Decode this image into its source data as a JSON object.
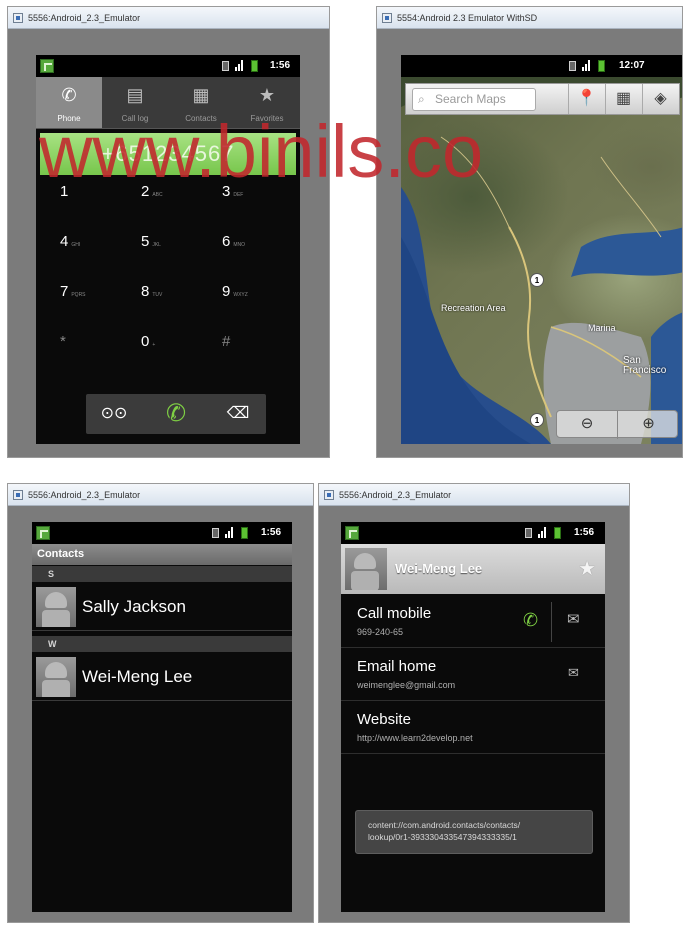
{
  "emulators": [
    {
      "title": "5556:Android_2.3_Emulator"
    },
    {
      "title": "5554:Android 2.3 Emulator WithSD"
    },
    {
      "title": "5556:Android_2.3_Emulator"
    },
    {
      "title": "5556:Android_2.3_Emulator"
    }
  ],
  "watermark": "www.binils.co",
  "colors": {
    "watermark": "#c2272d",
    "dial_green": "#77c64c",
    "call_green": "#7fd044"
  },
  "dialer": {
    "status_time": "1:56",
    "tabs": [
      {
        "label": "Phone",
        "icon": "phone-icon"
      },
      {
        "label": "Call log",
        "icon": "call-log-icon"
      },
      {
        "label": "Contacts",
        "icon": "contacts-icon"
      },
      {
        "label": "Favorites",
        "icon": "star-icon"
      }
    ],
    "number": "+651234567",
    "keys": [
      {
        "digit": "1",
        "letters": ""
      },
      {
        "digit": "2",
        "letters": "ABC"
      },
      {
        "digit": "3",
        "letters": "DEF"
      },
      {
        "digit": "4",
        "letters": "GHI"
      },
      {
        "digit": "5",
        "letters": "JKL"
      },
      {
        "digit": "6",
        "letters": "MNO"
      },
      {
        "digit": "7",
        "letters": "PQRS"
      },
      {
        "digit": "8",
        "letters": "TUV"
      },
      {
        "digit": "9",
        "letters": "WXYZ"
      },
      {
        "digit": "*",
        "letters": ""
      },
      {
        "digit": "0",
        "letters": "+"
      },
      {
        "digit": "#",
        "letters": ""
      }
    ]
  },
  "maps": {
    "status_time": "12:07",
    "search_placeholder": "Search Maps",
    "labels": {
      "recreation_area": "Recreation Area",
      "marina": "Marina",
      "san_francisco": "San\nFrancisco",
      "highway_1": "1"
    }
  },
  "contacts_list": {
    "status_time": "1:56",
    "title": "Contacts",
    "sections": [
      {
        "letter": "S",
        "name": "Sally Jackson"
      },
      {
        "letter": "W",
        "name": "Wei-Meng Lee"
      }
    ]
  },
  "contact_detail": {
    "status_time": "1:56",
    "name": "Wei-Meng Lee",
    "rows": [
      {
        "title": "Call mobile",
        "subtitle": "969-240-65"
      },
      {
        "title": "Email home",
        "subtitle": "weimenglee@gmail.com"
      },
      {
        "title": "Website",
        "subtitle": "http://www.learn2develop.net"
      }
    ],
    "uri": "content://com.android.contacts/contacts/\nlookup/0r1-393330433547394333335/1"
  }
}
